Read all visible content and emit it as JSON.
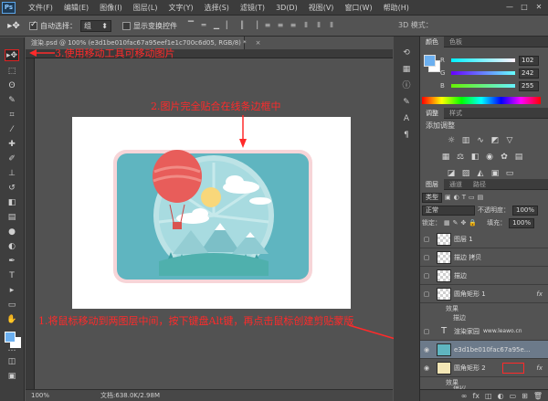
{
  "menubar": {
    "logo": "Ps",
    "items": [
      "文件(F)",
      "编辑(E)",
      "图像(I)",
      "图层(L)",
      "文字(Y)",
      "选择(S)",
      "滤镜(T)",
      "3D(D)",
      "视图(V)",
      "窗口(W)",
      "帮助(H)"
    ],
    "controls": [
      "—",
      "□",
      "✕"
    ]
  },
  "options": {
    "auto_select_label": "自动选择：",
    "auto_select_value": "组",
    "transform_label": "显示变换控件",
    "mode3d": "3D 模式："
  },
  "document": {
    "tab_title": "渲染.psd @ 100% (e3d1be010fac67a95eef1e1c700c6d05, RGB/8) *",
    "close": "×",
    "zoom": "100%",
    "size": "文档:638.0K/2.98M"
  },
  "annotations": {
    "a1": "1.将鼠标移动到两图层中间，按下键盘Alt键，再点击鼠标创建剪贴蒙版",
    "a2": "2.图片完全贴合在线条边框中",
    "a3": "3.使用移动工具可移动图片"
  },
  "color_panel": {
    "tabs": [
      "颜色",
      "色板"
    ],
    "r_label": "R",
    "g_label": "G",
    "b_label": "B",
    "r": "102",
    "g": "242",
    "b": "255",
    "foreground": "#6cb0f0"
  },
  "adjust_panel": {
    "tabs": [
      "调整",
      "样式"
    ],
    "title": "添加调整"
  },
  "layers_panel": {
    "tabs": [
      "图层",
      "通道",
      "路径"
    ],
    "kind": "类型",
    "blend": "正常",
    "opacity_label": "不透明度：",
    "opacity": "100%",
    "lock_label": "锁定：",
    "fill_label": "填充：",
    "fill": "100%",
    "layers": [
      {
        "name": "图层 1",
        "fx": ""
      },
      {
        "name": "描边 拷贝",
        "fx": ""
      },
      {
        "name": "描边",
        "fx": ""
      },
      {
        "name": "圆角矩形 1",
        "fx": "fx"
      },
      {
        "name": "渲染家园",
        "fx": ""
      },
      {
        "name": "e3d1be010fac67a95e...",
        "fx": ""
      },
      {
        "name": "圆角矩形 2",
        "fx": "fx"
      }
    ],
    "effects_label": "效果",
    "stroke_label": "描边",
    "text_layer_url": "www.leawo.cn"
  }
}
